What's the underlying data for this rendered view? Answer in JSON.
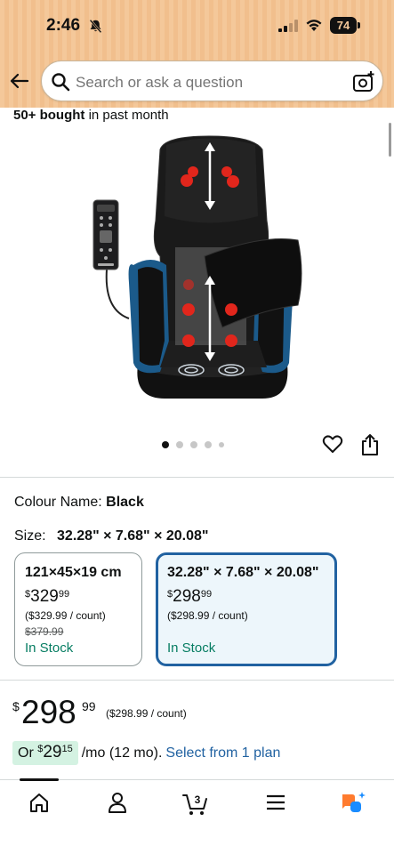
{
  "status_bar": {
    "time": "2:46",
    "battery": "74"
  },
  "search": {
    "placeholder": "Search or ask a question"
  },
  "product": {
    "bought_strong": "50+ bought",
    "bought_rest": " in past month",
    "image_count": 5,
    "active_image_index": 0
  },
  "variations": {
    "colour_label": "Colour Name:",
    "colour_value": "Black",
    "size_label": "Size:",
    "size_value": "32.28\" × 7.68\" × 20.08\"",
    "cards": [
      {
        "title": "121×45×19 cm",
        "price_symbol": "$",
        "price_whole": "329",
        "price_fraction": "99",
        "unit_price": "($329.99 / count)",
        "was_price": "$379.99",
        "stock": "In Stock",
        "selected": false
      },
      {
        "title": "32.28\" × 7.68\" × 20.08\"",
        "price_symbol": "$",
        "price_whole": "298",
        "price_fraction": "99",
        "unit_price": "($298.99 / count)",
        "stock": "In Stock",
        "selected": true
      }
    ]
  },
  "price": {
    "symbol": "$",
    "whole": "298",
    "fraction": "99",
    "unit": "($298.99 / count)"
  },
  "plan": {
    "prefix": "Or ",
    "symbol": "$",
    "whole": "29",
    "fraction": "15",
    "term": "/mo (12 mo).",
    "link": "Select from 1 plan"
  },
  "tabbar": {
    "cart_count": "3",
    "tabs": [
      "home-icon",
      "account-icon",
      "cart-icon",
      "menu-icon",
      "assistant-icon"
    ]
  },
  "colors": {
    "header": "#f4c89a",
    "link": "#2162a1",
    "in_stock": "#067d62",
    "selected_card_border": "#2162a1",
    "selected_card_bg": "#edf6fb",
    "plan_chip": "#d4f2e2",
    "assistant_orange": "#ff7b2e",
    "assistant_blue": "#1a8cff"
  }
}
